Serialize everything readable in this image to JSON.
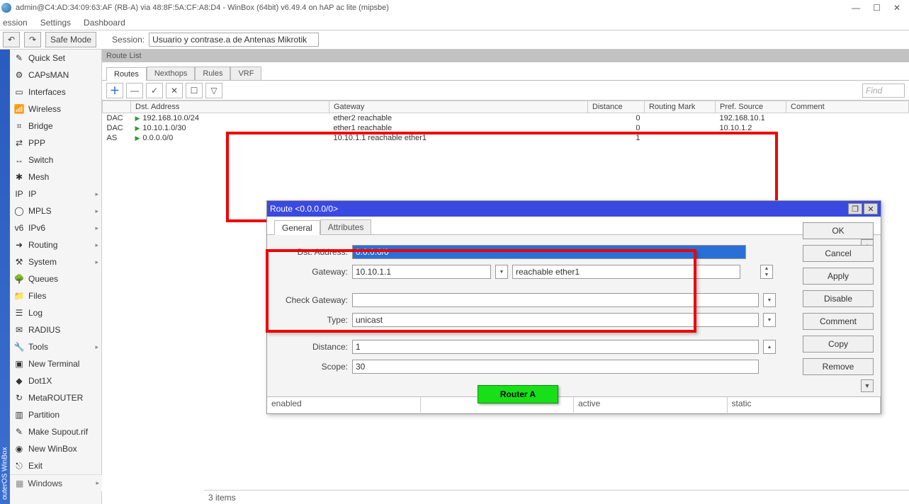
{
  "window": {
    "title": "admin@C4:AD:34:09:63:AF (RB-A) via 48:8F:5A:CF:A8:D4 - WinBox (64bit) v6.49.4 on hAP ac lite (mipsbe)"
  },
  "menubar": [
    "ession",
    "Settings",
    "Dashboard"
  ],
  "toolbar": {
    "safe_mode": "Safe Mode",
    "session_label": "Session:",
    "session_value": "Usuario y contrase.a de Antenas Mikrotik"
  },
  "sidebar": [
    {
      "label": "Quick Set",
      "icon": "✎",
      "caret": false
    },
    {
      "label": "CAPsMAN",
      "icon": "⚙",
      "caret": false
    },
    {
      "label": "Interfaces",
      "icon": "▭",
      "caret": false
    },
    {
      "label": "Wireless",
      "icon": "📶",
      "caret": false
    },
    {
      "label": "Bridge",
      "icon": "⌗",
      "caret": false
    },
    {
      "label": "PPP",
      "icon": "⇄",
      "caret": false
    },
    {
      "label": "Switch",
      "icon": "↔",
      "caret": false
    },
    {
      "label": "Mesh",
      "icon": "✱",
      "caret": false
    },
    {
      "label": "IP",
      "icon": "IP",
      "caret": true
    },
    {
      "label": "MPLS",
      "icon": "◯",
      "caret": true
    },
    {
      "label": "IPv6",
      "icon": "v6",
      "caret": true
    },
    {
      "label": "Routing",
      "icon": "➜",
      "caret": true
    },
    {
      "label": "System",
      "icon": "⚒",
      "caret": true
    },
    {
      "label": "Queues",
      "icon": "🌳",
      "caret": false
    },
    {
      "label": "Files",
      "icon": "📁",
      "caret": false
    },
    {
      "label": "Log",
      "icon": "☰",
      "caret": false
    },
    {
      "label": "RADIUS",
      "icon": "✉",
      "caret": false
    },
    {
      "label": "Tools",
      "icon": "🔧",
      "caret": true
    },
    {
      "label": "New Terminal",
      "icon": "▣",
      "caret": false
    },
    {
      "label": "Dot1X",
      "icon": "◆",
      "caret": false
    },
    {
      "label": "MetaROUTER",
      "icon": "↻",
      "caret": false
    },
    {
      "label": "Partition",
      "icon": "▥",
      "caret": false
    },
    {
      "label": "Make Supout.rif",
      "icon": "✎",
      "caret": false
    },
    {
      "label": "New WinBox",
      "icon": "◉",
      "caret": false
    },
    {
      "label": "Exit",
      "icon": "⎋",
      "caret": false
    }
  ],
  "windows_menu": "Windows",
  "vspine": "outerOS  WinBox",
  "routelist": {
    "title": "Route List",
    "tabs": [
      "Routes",
      "Nexthops",
      "Rules",
      "VRF"
    ],
    "find": "Find",
    "headers": [
      "",
      "Dst. Address",
      "Gateway",
      "Distance",
      "Routing Mark",
      "Pref. Source",
      "Comment"
    ],
    "rows": [
      {
        "flag": "DAC",
        "addr": "192.168.10.0/24",
        "gw": "ether2 reachable",
        "dist": "0",
        "mark": "",
        "pref": "192.168.10.1",
        "comment": ""
      },
      {
        "flag": "DAC",
        "addr": "10.10.1.0/30",
        "gw": "ether1 reachable",
        "dist": "0",
        "mark": "",
        "pref": "10.10.1.2",
        "comment": ""
      },
      {
        "flag": "AS",
        "addr": "0.0.0.0/0",
        "gw": "10.10.1.1 reachable ether1",
        "dist": "1",
        "mark": "",
        "pref": "",
        "comment": ""
      }
    ]
  },
  "dialog": {
    "title": "Route <0.0.0.0/0>",
    "tabs": [
      "General",
      "Attributes"
    ],
    "labels": {
      "dst": "Dst. Address:",
      "gw": "Gateway:",
      "check": "Check Gateway:",
      "type": "Type:",
      "distance": "Distance:",
      "scope": "Scope:"
    },
    "values": {
      "dst": "0.0.0.0/0",
      "gw": "10.10.1.1",
      "gw_status": "reachable ether1",
      "check": "",
      "type": "unicast",
      "distance": "1",
      "scope": "30"
    },
    "buttons": [
      "OK",
      "Cancel",
      "Apply",
      "Disable",
      "Comment",
      "Copy",
      "Remove"
    ],
    "status": [
      "enabled",
      "",
      "active",
      "static"
    ]
  },
  "router_label": "Router A",
  "footer": "3 items"
}
